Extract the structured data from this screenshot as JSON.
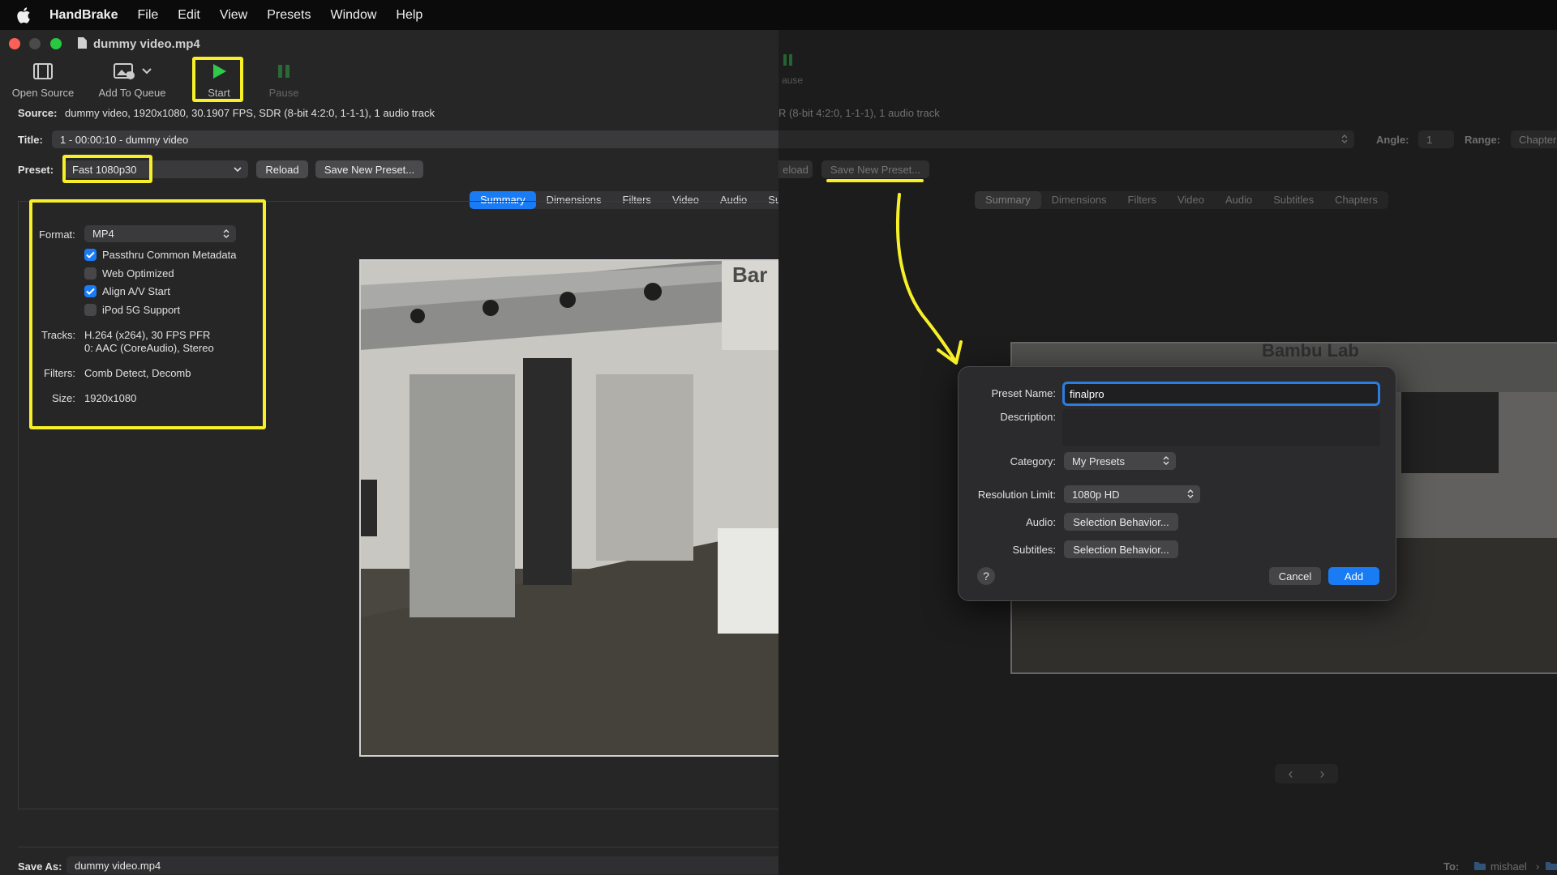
{
  "menubar": {
    "app": "HandBrake",
    "items": [
      "File",
      "Edit",
      "View",
      "Presets",
      "Window",
      "Help"
    ]
  },
  "window": {
    "title": "dummy video.mp4"
  },
  "toolbar": {
    "open_source": "Open Source",
    "add_to_queue": "Add To Queue",
    "start": "Start",
    "pause": "Pause"
  },
  "source": {
    "label": "Source:",
    "value": "dummy video, 1920x1080, 30.1907 FPS, SDR (8-bit 4:2:0, 1-1-1), 1 audio track"
  },
  "title_row": {
    "label": "Title:",
    "value": "1 - 00:00:10 - dummy video"
  },
  "preset": {
    "label": "Preset:",
    "value": "Fast 1080p30",
    "reload": "Reload",
    "save_new": "Save New Preset..."
  },
  "tabs": [
    "Summary",
    "Dimensions",
    "Filters",
    "Video",
    "Audio",
    "Sub"
  ],
  "summary": {
    "format_label": "Format:",
    "format_value": "MP4",
    "checks": [
      {
        "label": "Passthru Common Metadata",
        "checked": true
      },
      {
        "label": "Web Optimized",
        "checked": false
      },
      {
        "label": "Align A/V Start",
        "checked": true
      },
      {
        "label": "iPod 5G Support",
        "checked": false
      }
    ],
    "tracks_label": "Tracks:",
    "tracks_line1": "H.264 (x264), 30 FPS PFR",
    "tracks_line2": "0: AAC (CoreAudio), Stereo",
    "filters_label": "Filters:",
    "filters_value": "Comb Detect, Decomb",
    "size_label": "Size:",
    "size_value": "1920x1080"
  },
  "preview": {
    "logo_text": "Bar"
  },
  "save_as": {
    "label": "Save As:",
    "value": "dummy video.mp4"
  },
  "right": {
    "pause": "ause",
    "source_tail": "R (8-bit 4:2:0, 1-1-1), 1 audio track",
    "angle_label": "Angle:",
    "angle_value": "1",
    "range_label": "Range:",
    "range_value": "Chapter",
    "reload_tail": "eload",
    "save_new": "Save New Preset...",
    "tabs": [
      "Summary",
      "Dimensions",
      "Filters",
      "Video",
      "Audio",
      "Subtitles",
      "Chapters"
    ],
    "preview_logo": "Bambu Lab",
    "to_label": "To:",
    "to_value": "mishael",
    "nav_prev": "‹",
    "nav_next": "›"
  },
  "dialog": {
    "preset_name_label": "Preset Name:",
    "preset_name_value": "finalpro",
    "description_label": "Description:",
    "category_label": "Category:",
    "category_value": "My Presets",
    "resolution_label": "Resolution Limit:",
    "resolution_value": "1080p HD",
    "audio_label": "Audio:",
    "audio_value": "Selection Behavior...",
    "subtitles_label": "Subtitles:",
    "subtitles_value": "Selection Behavior...",
    "help": "?",
    "cancel": "Cancel",
    "add": "Add"
  },
  "colors": {
    "accent": "#1a7cf5",
    "highlight": "#f7ef27",
    "close": "#fe5f57",
    "minimize": "#febc2e",
    "zoom": "#28c840"
  }
}
